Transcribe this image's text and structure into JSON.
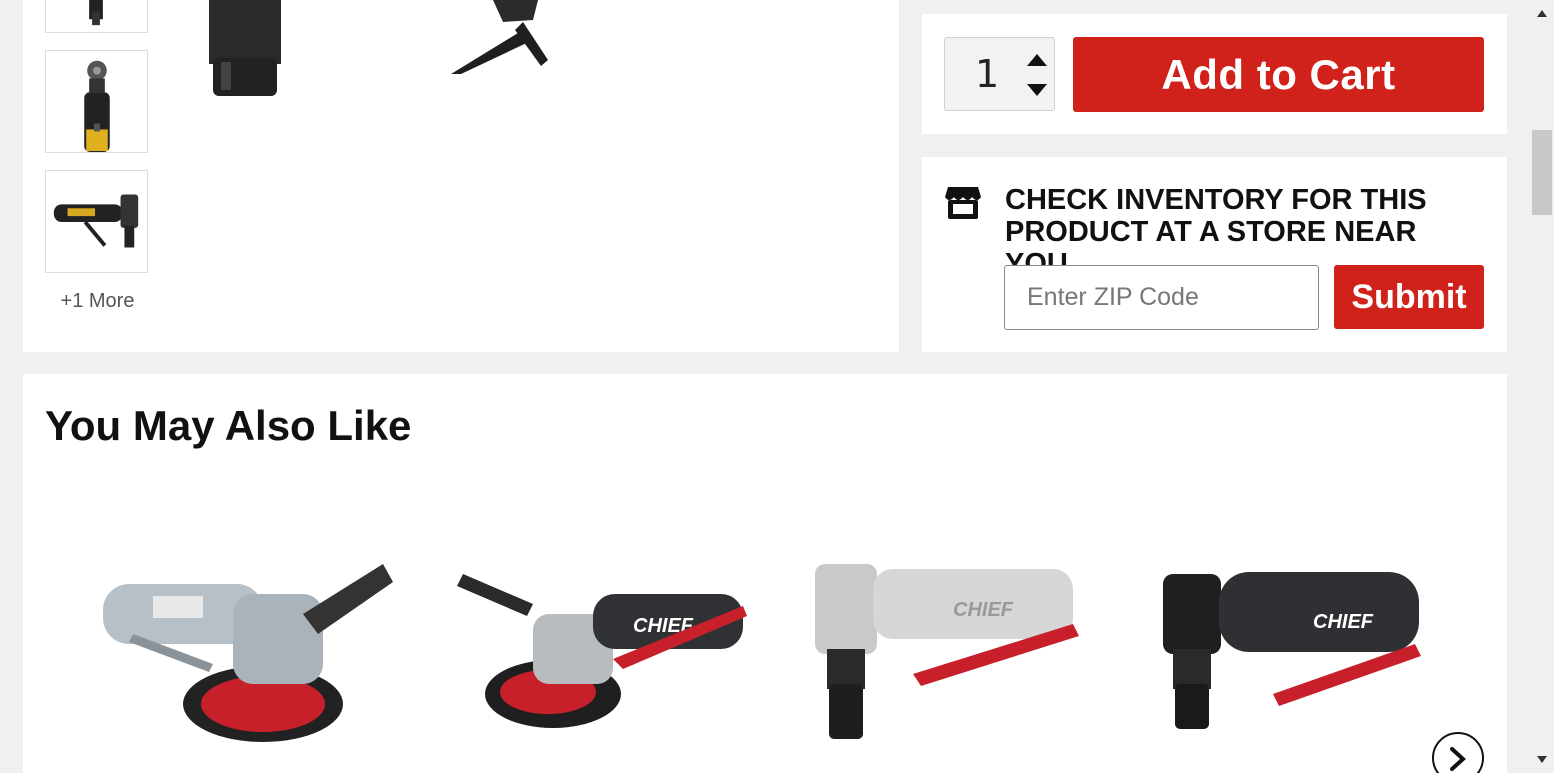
{
  "gallery": {
    "more_label": "+1 More"
  },
  "cart": {
    "quantity": "1",
    "add_to_cart_label": "Add to Cart",
    "accent_color": "#d0211a"
  },
  "inventory": {
    "title_line1": "CHECK INVENTORY FOR THIS",
    "title_line2": "PRODUCT AT A STORE NEAR YOU",
    "zip_placeholder": "Enter ZIP Code",
    "submit_label": "Submit"
  },
  "recommendations": {
    "title": "You May Also Like",
    "items": [
      {
        "brand": "",
        "icon": "angle-grinder-silver"
      },
      {
        "brand": "CHIEF",
        "icon": "angle-grinder-black"
      },
      {
        "brand": "CHIEF",
        "icon": "angle-die-grinder-chrome"
      },
      {
        "brand": "CHIEF",
        "icon": "angle-die-grinder-black"
      }
    ]
  }
}
